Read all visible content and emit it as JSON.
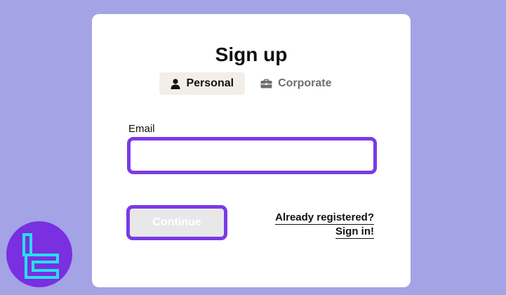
{
  "title": "Sign up",
  "tabs": [
    {
      "label": "Personal",
      "icon": "person-icon",
      "active": true
    },
    {
      "label": "Corporate",
      "icon": "briefcase-icon",
      "active": false
    }
  ],
  "email": {
    "label": "Email",
    "value": "",
    "placeholder": ""
  },
  "continue_label": "Continue",
  "signin": {
    "question": "Already registered?",
    "link": "Sign in!"
  },
  "colors": {
    "background": "#a3a3e6",
    "accent": "#7a3ae6",
    "active_tab_bg": "#f3efe8",
    "logo_bg": "#7a2fe0",
    "logo_stroke": "#27e0f0"
  }
}
